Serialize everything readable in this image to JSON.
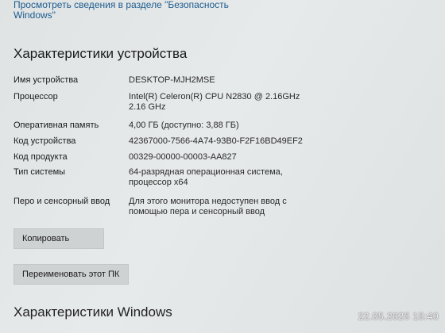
{
  "top_link": "Просмотреть сведения в разделе \"Безопасность Windows\"",
  "specs_section": {
    "title": "Характеристики устройства",
    "rows": [
      {
        "label": "Имя устройства",
        "value": "DESKTOP-MJH2MSE"
      },
      {
        "label": "Процессор",
        "value": "Intel(R) Celeron(R) CPU  N2830  @ 2.16GHz   2.16 GHz"
      },
      {
        "label": "Оперативная память",
        "value": "4,00 ГБ (доступно: 3,88 ГБ)"
      },
      {
        "label": "Код устройства",
        "value": "42367000-7566-4A74-93B0-F2F16BD49EF2"
      },
      {
        "label": "Код продукта",
        "value": "00329-00000-00003-AA827"
      },
      {
        "label": "Тип системы",
        "value": "64-разрядная операционная система, процессор x64"
      },
      {
        "label": "Перо и сенсорный ввод",
        "value": "Для этого монитора недоступен ввод с помощью пера и сенсорный ввод"
      }
    ]
  },
  "buttons": {
    "copy": "Копировать",
    "rename": "Переименовать этот ПК"
  },
  "windows_section": {
    "title": "Характеристики Windows"
  },
  "timestamp": "22.05.2025 15:40"
}
